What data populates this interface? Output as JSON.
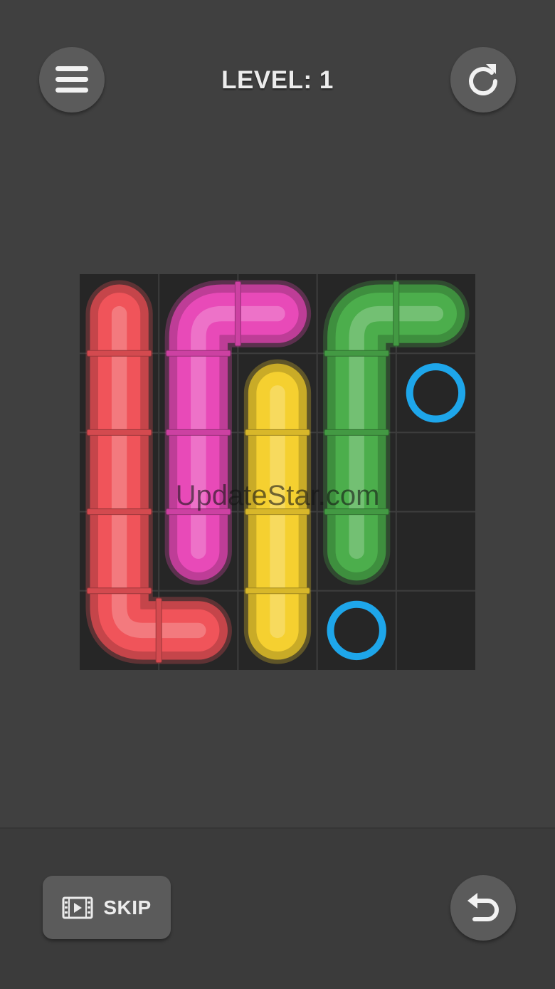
{
  "header": {
    "title": "LEVEL: 1"
  },
  "icons": {
    "menu": "hamburger-menu-icon",
    "restart": "restart-icon",
    "undo": "undo-icon",
    "skip": "video-film-icon"
  },
  "board": {
    "rows": 5,
    "cols": 5,
    "pipes": [
      {
        "color": "red",
        "hex": "#f0545a",
        "path": [
          [
            0,
            0
          ],
          [
            1,
            0
          ],
          [
            2,
            0
          ],
          [
            3,
            0
          ],
          [
            4,
            0
          ],
          [
            4,
            1
          ]
        ]
      },
      {
        "color": "magenta",
        "hex": "#e84ab8",
        "path": [
          [
            0,
            2
          ],
          [
            0,
            1
          ],
          [
            1,
            1
          ],
          [
            2,
            1
          ],
          [
            3,
            1
          ]
        ]
      },
      {
        "color": "yellow",
        "hex": "#f5d030",
        "path": [
          [
            1,
            2
          ],
          [
            2,
            2
          ],
          [
            3,
            2
          ],
          [
            4,
            2
          ]
        ]
      },
      {
        "color": "green",
        "hex": "#4cae4c",
        "path": [
          [
            0,
            4
          ],
          [
            0,
            3
          ],
          [
            1,
            3
          ],
          [
            2,
            3
          ],
          [
            3,
            3
          ]
        ]
      }
    ],
    "endpoints": [
      {
        "color": "blue",
        "hex": "#1ea6ea",
        "cell": [
          1,
          4
        ]
      },
      {
        "color": "blue",
        "hex": "#1ea6ea",
        "cell": [
          4,
          3
        ]
      }
    ]
  },
  "watermark": "UpdateStar.com",
  "footer": {
    "skip_label": "SKIP"
  }
}
